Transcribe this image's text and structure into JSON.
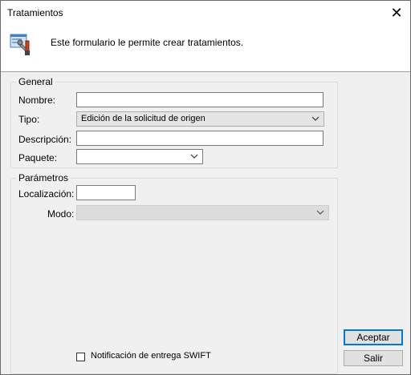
{
  "window": {
    "title": "Tratamientos"
  },
  "header": {
    "description": "Este formulario le permite crear tratamientos."
  },
  "general": {
    "title": "General",
    "nombre_label": "Nombre:",
    "nombre_value": "",
    "tipo_label": "Tipo:",
    "tipo_value": "Edición de la solicitud de origen",
    "descripcion_label": "Descripción:",
    "descripcion_value": "",
    "paquete_label": "Paquete:",
    "paquete_value": ""
  },
  "parametros": {
    "title": "Parámetros",
    "localizacion_label": "Localización:",
    "localizacion_value": "",
    "modo_label": "Modo:",
    "modo_value": ""
  },
  "swift": {
    "label": "Notificación de entrega SWIFT",
    "checked": false
  },
  "buttons": {
    "accept": "Aceptar",
    "exit": "Salir"
  }
}
